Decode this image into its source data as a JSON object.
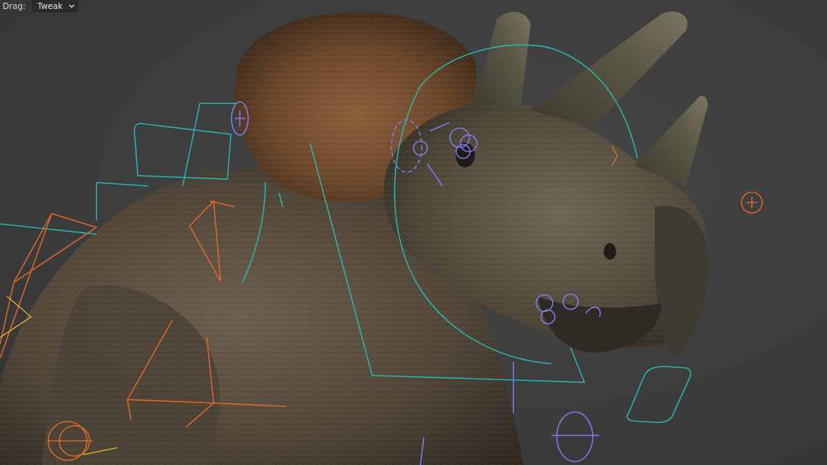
{
  "header": {
    "drag_label": "Drag:",
    "drag_mode": {
      "selected": "Tweak",
      "icon": "chevron-down-icon"
    }
  },
  "colors": {
    "viewport_bg": "#3d3d3d",
    "face_control": "#29b8b0",
    "fk_bone": "#e0692a",
    "ik_bone": "#e8b830",
    "deform_control": "#7f7ff0",
    "model_skin": "#5b4c3d"
  },
  "scene": {
    "object": "triceratops-model",
    "rig_controls": [
      "face-control-cyan",
      "bone-control-orange",
      "detail-control-violet"
    ]
  }
}
